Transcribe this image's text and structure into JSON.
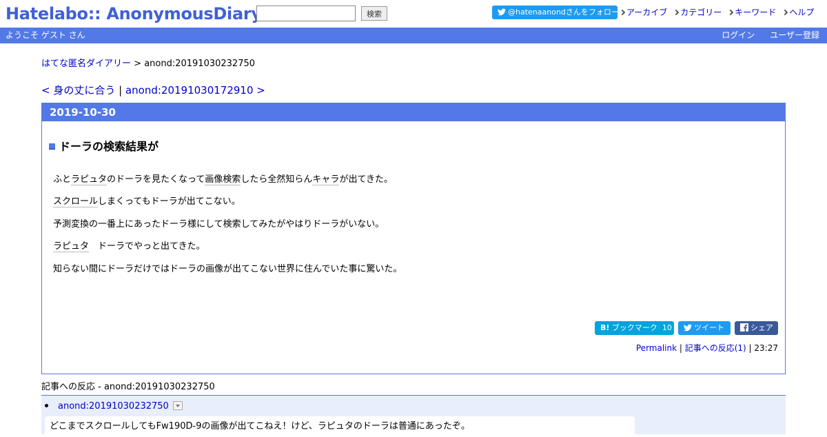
{
  "header": {
    "logo": "Hatelabo:: AnonymousDiary",
    "search_placeholder": "",
    "search_button": "検索",
    "follow_label": "@hatenaanondさんをフォロー",
    "links": [
      "アーカイブ",
      "カテゴリー",
      "キーワード",
      "ヘルプ"
    ]
  },
  "bar": {
    "welcome": "ようこそ ゲスト さん",
    "login": "ログイン",
    "register": "ユーザー登録"
  },
  "breadcrumb": {
    "home": "はてな匿名ダイアリー",
    "separator": " > ",
    "current": "anond:20191030232750"
  },
  "prevnext": {
    "prev": "< 身の丈に合う",
    "separator": " | ",
    "next": "anond:20191030172910 >"
  },
  "day": {
    "date": "2019-10-30",
    "title_marker": "■",
    "title": "ドーラの検索結果が",
    "paragraphs": {
      "p1": {
        "a": "ふと",
        "kw1": "ラピュタ",
        "b": "のドーラを見たくなって",
        "kw2": "画像検索",
        "c": "したら全然知らん",
        "kw3": "キャラ",
        "d": "が出てきた。"
      },
      "p2": {
        "kw1": "スクロール",
        "a": "しまくってもドーラが出てこない。"
      },
      "p3": {
        "a": "予測変換の一番上にあったドーラ様にして検索してみたがやはりドーラがいない。"
      },
      "p4": {
        "kw1": "ラピュタ",
        "a": "　ドーラでやっと出てきた。"
      },
      "p5": {
        "a": "知らない間にドーラだけではドーラの画像が出てこない世界に住んでいた事に驚いた。"
      }
    },
    "share": {
      "bookmark_label": "ブックマーク",
      "bookmark_count": "10",
      "tweet_label": "ツイート",
      "share_label": "シェア"
    },
    "footer": {
      "permalink": "Permalink",
      "sep1": " | ",
      "reactions": "記事への反応(1)",
      "sep2": " | ",
      "time": "23:27"
    }
  },
  "reactions": {
    "title": "記事への反応 - anond:20191030232750",
    "items": [
      {
        "link": "anond:20191030232750",
        "body": "どこまでスクロールしてもFw190D-9の画像が出てこねえ！けど、ラピュタのドーラは普通にあったぞ。"
      }
    ]
  },
  "colors": {
    "accent": "#5279e7",
    "link": "#0000cc",
    "twitter": "#1d9bf0",
    "hatena_bookmark": "#00a4de",
    "facebook": "#3b5998"
  }
}
